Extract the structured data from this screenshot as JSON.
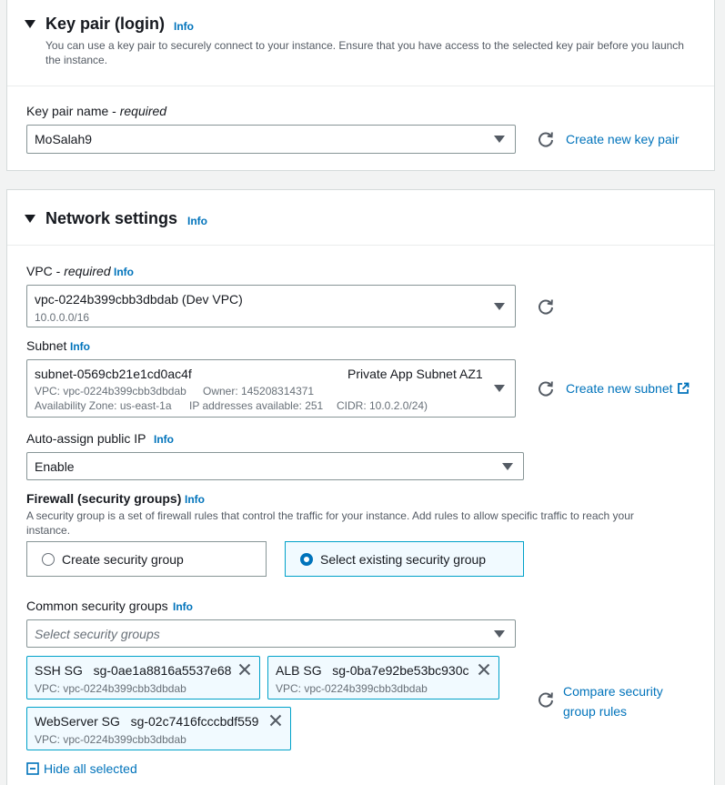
{
  "key_pair": {
    "title": "Key pair (login)",
    "info": "Info",
    "description_line1": "You can use a key pair to securely connect to your instance. Ensure that you have access to the selected key pair before you launch",
    "description_line2": "the instance.",
    "label": "Key pair name - ",
    "label_required": "required",
    "selected_value": "MoSalah9",
    "create_link": "Create new key pair"
  },
  "network": {
    "title": "Network settings",
    "info": "Info",
    "vpc": {
      "label": "VPC - ",
      "label_required": "required",
      "info": "Info",
      "value": "vpc-0224b399cbb3dbdab (Dev VPC)",
      "cidr": "10.0.0.0/16"
    },
    "subnet": {
      "label": "Subnet",
      "info": "Info",
      "value": "subnet-0569cb21e1cd0ac4f",
      "name": "Private App Subnet AZ1",
      "vpc_line": "VPC: vpc-0224b399cbb3dbdab",
      "owner_line": "Owner: 145208314371",
      "az_line": "Availability Zone: us-east-1a",
      "ips_line": "IP addresses available: 251",
      "cidr_line": "CIDR: 10.0.2.0/24)",
      "create_link": "Create new subnet"
    },
    "public_ip": {
      "label": "Auto-assign public IP",
      "info": "Info",
      "value": "Enable"
    },
    "firewall": {
      "label": "Firewall (security groups)",
      "info": "Info",
      "description_line1": "A security group is a set of firewall rules that control the traffic for your instance. Add rules to allow specific traffic to reach your",
      "description_line2": "instance.",
      "option_create": "Create security group",
      "option_existing": "Select existing security group",
      "selected": "existing"
    },
    "common_sg": {
      "label": "Common security groups",
      "info": "Info",
      "placeholder": "Select security groups",
      "tokens": [
        {
          "name": "SSH SG",
          "id": "sg-0ae1a8816a5537e68",
          "vpc": "VPC: vpc-0224b399cbb3dbdab"
        },
        {
          "name": "ALB SG",
          "id": "sg-0ba7e92be53bc930c",
          "vpc": "VPC: vpc-0224b399cbb3dbdab"
        },
        {
          "name": "WebServer SG",
          "id": "sg-02c7416fcccbdf559",
          "vpc": "VPC: vpc-0224b399cbb3dbdab"
        }
      ],
      "compare_line1": "Compare security",
      "compare_line2": "group rules",
      "hide_all": "Hide all selected"
    }
  },
  "colors": {
    "link": "#0073bb",
    "selected_border": "#00a1c9",
    "selected_bg": "#f1faff"
  }
}
